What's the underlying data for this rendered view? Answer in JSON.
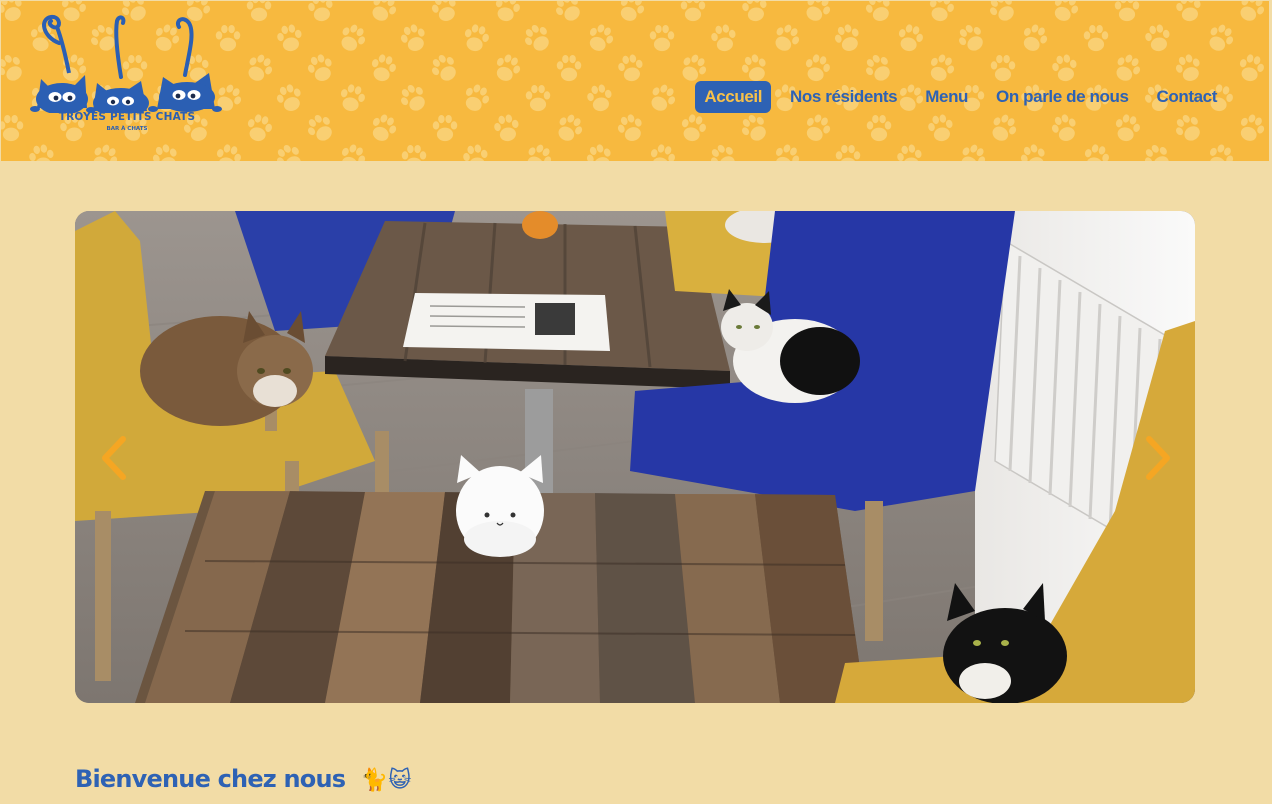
{
  "header": {
    "logo": {
      "title": "TROYES PETITS CHATS",
      "subtitle": "BAR À CHATS"
    },
    "nav": [
      {
        "label": "Accueil",
        "active": true
      },
      {
        "label": "Nos résidents",
        "active": false
      },
      {
        "label": "Menu",
        "active": false
      },
      {
        "label": "On parle de nous",
        "active": false
      },
      {
        "label": "Contact",
        "active": false
      }
    ]
  },
  "carousel": {
    "prev_icon": "chevron-left-icon",
    "next_icon": "chevron-right-icon"
  },
  "welcome": {
    "heading": "Bienvenue chez nous",
    "emoji": "🐈😺"
  },
  "colors": {
    "header_bg": "#f7b93f",
    "page_bg": "#f2dca6",
    "brand_blue": "#2e62b4",
    "arrow": "#f5a623"
  }
}
